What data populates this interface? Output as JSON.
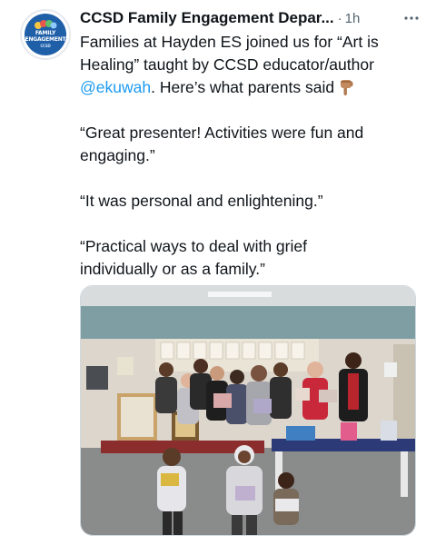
{
  "tweet": {
    "author_name": "CCSD Family Engagement Depar...",
    "separator": "·",
    "time": "1h",
    "avatar": {
      "line1": "FAMILY",
      "line2": "ENGAGEMENT",
      "line3": "CCSD"
    },
    "text": {
      "line1": "Families at Hayden ES joined us for “Art is",
      "line2": "Healing” taught by CCSD educator/author",
      "mention": "@ekuwah",
      "line3_rest": ". Here’s what parents said",
      "quote1_line1": "“Great presenter! Activities were fun and",
      "quote1_line2": "engaging.”",
      "quote2": "“It was personal and enlightening.”",
      "quote3_line1": "“Practical ways to deal with grief",
      "quote3_line2": "individually or as a family.”"
    },
    "icons": [
      "more-icon",
      "point-down-emoji"
    ],
    "colors": {
      "mention": "#1d9bf0",
      "text": "#0f1419",
      "secondary": "#536471"
    }
  }
}
